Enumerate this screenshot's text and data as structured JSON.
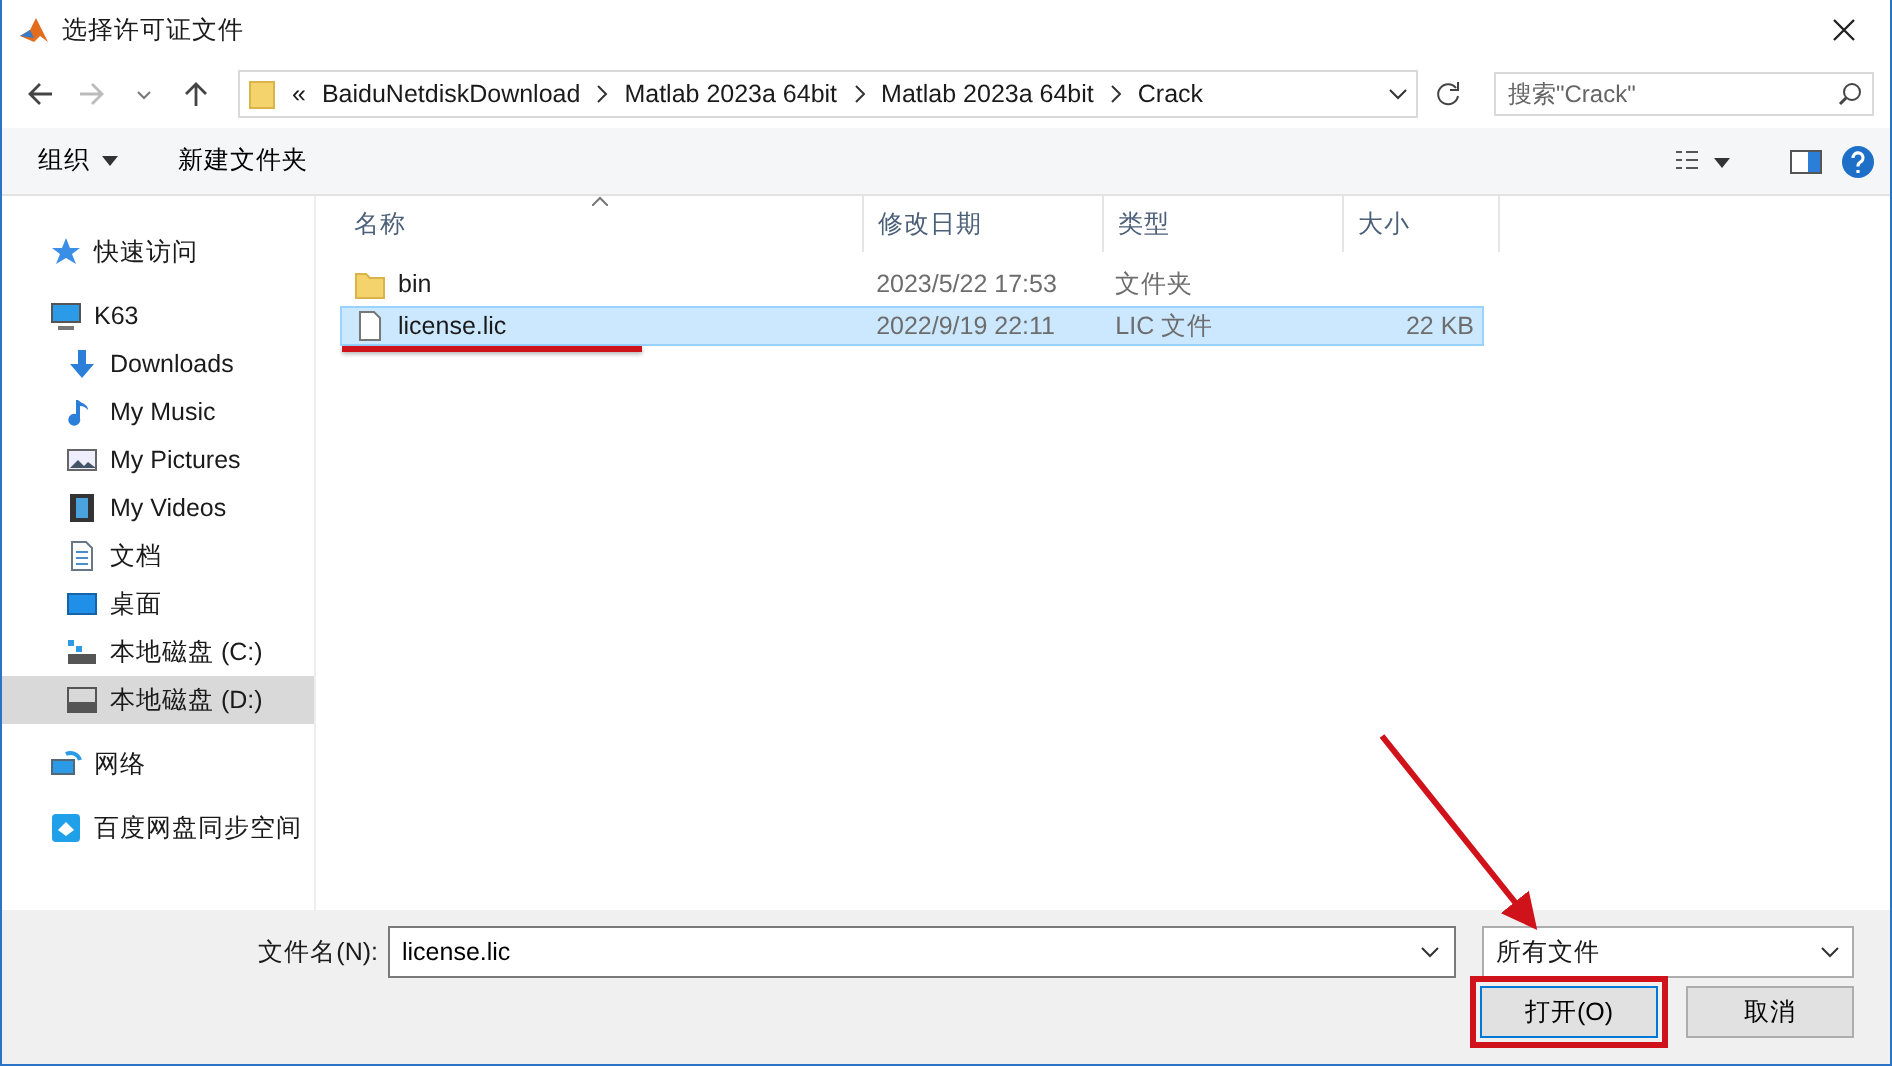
{
  "window": {
    "title": "选择许可证文件"
  },
  "address_bar": {
    "overflow": "«",
    "path": [
      "BaiduNetdiskDownload",
      "Matlab 2023a 64bit",
      "Matlab 2023a 64bit",
      "Crack"
    ]
  },
  "search": {
    "placeholder": "搜索\"Crack\""
  },
  "toolbar": {
    "organize": "组织",
    "new_folder": "新建文件夹"
  },
  "sidebar": {
    "items": [
      {
        "label": "快速访问",
        "kind": "star",
        "selected": false
      },
      {
        "label": "K63",
        "kind": "pc",
        "selected": false,
        "children": [
          {
            "label": "Downloads",
            "kind": "download",
            "selected": false
          },
          {
            "label": "My Music",
            "kind": "music",
            "selected": false
          },
          {
            "label": "My Pictures",
            "kind": "pictures",
            "selected": false
          },
          {
            "label": "My Videos",
            "kind": "videos",
            "selected": false
          },
          {
            "label": "文档",
            "kind": "document",
            "selected": false
          },
          {
            "label": "桌面",
            "kind": "desktop",
            "selected": false
          },
          {
            "label": "本地磁盘 (C:)",
            "kind": "system-drive",
            "selected": false
          },
          {
            "label": "本地磁盘 (D:)",
            "kind": "drive",
            "selected": true
          }
        ]
      },
      {
        "label": "网络",
        "kind": "network",
        "selected": false
      },
      {
        "label": "百度网盘同步空间",
        "kind": "cloud",
        "selected": false
      }
    ]
  },
  "table": {
    "columns": [
      "名称",
      "修改日期",
      "类型",
      "大小"
    ],
    "rows": [
      {
        "kind": "folder",
        "name": "bin",
        "modified": "2023/5/22 17:53",
        "type": "文件夹",
        "selected": false,
        "underlined": false
      },
      {
        "kind": "file",
        "name": "license.lic",
        "modified": "2022/9/19 22:11",
        "type": "LIC 文件",
        "size": "22 KB",
        "selected": true,
        "underlined": true
      }
    ]
  },
  "file_name": {
    "label": "文件名(N):",
    "value": "license.lic"
  },
  "file_type": {
    "value": "所有文件"
  },
  "buttons": [
    {
      "label": "打开(O)",
      "highlighted": true
    },
    {
      "label": "取消",
      "highlighted": false
    }
  ]
}
